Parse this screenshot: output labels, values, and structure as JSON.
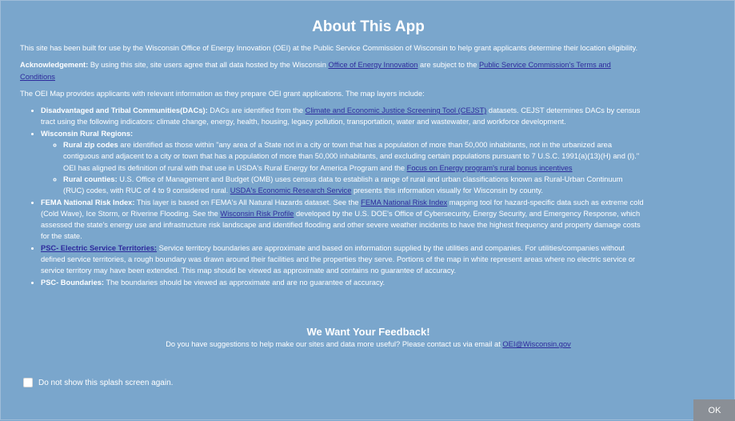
{
  "modal": {
    "title": "About This App",
    "intro": "This site has been built for use by the Wisconsin Office of Energy Innovation (OEI) at the Public Service Commission of Wisconsin to help grant applicants determine their location eligibility.",
    "ack_label": "Acknowledgement:",
    "ack_text_1": " By using this site, site users agree that all data hosted by the Wisconsin ",
    "ack_link_1": "Office of Energy Innovation",
    "ack_text_2": " are subject to the ",
    "ack_link_2a": "Public Service Commission's Terms and",
    "ack_link_2b": "Conditions",
    "map_intro": "The OEI Map provides applicants with relevant information as they prepare OEI grant applications. The map layers include:",
    "dac_label": "Disadvantaged and Tribal Communities(DACs):",
    "dac_text_1": " DACs are identified from the ",
    "dac_link": "Climate and Economic Justice Screening Tool (CEJST)",
    "dac_text_2": " datasets. CEJST determines DACs by census",
    "dac_text_3": "tract using the following indicators: climate change, energy, health, housing, legacy pollution, transportation, water and wastewater, and workforce development.",
    "rural_label": "Wisconsin Rural Regions:",
    "zip_label": "Rural zip codes",
    "zip_text_1": " are identified as those within \"any area of a State not in a city or town that has a population of more than 50,000 inhabitants, not in the urbanized area",
    "zip_text_2": "contiguous and adjacent to a city or town that has a population of more than 50,000 inhabitants, and excluding certain populations pursuant to 7 U.S.C. 1991(a)(13)(H) and (I).\"",
    "zip_text_3": "OEI has aligned its definition of rural with that use in USDA's Rural Energy for America Program and the ",
    "zip_link": "Focus on Energy program's rural bonus incentives",
    "counties_label": "Rural counties:",
    "counties_text_1": " U.S. Office of Management and Budget (OMB) uses census data to establish a range of rural and urban classifications known as Rural-Urban Continuum",
    "counties_text_2": "(RUC) codes, with RUC of 4 to 9 considered rural. ",
    "counties_link": "USDA's Economic Research Service",
    "counties_text_3": " presents this information visually for Wisconsin by county.",
    "fema_label": "FEMA National Risk Index:",
    "fema_text_1": " This layer is based on FEMA's All Natural Hazards dataset. See the ",
    "fema_link": "FEMA National Risk Index",
    "fema_text_2": " mapping tool for hazard-specific data such as extreme cold",
    "fema_text_3": "(Cold Wave), Ice Storm, or Riverine Flooding. See the ",
    "fema_link_2": "Wisconsin Risk Profile",
    "fema_text_4": " developed by the U.S. DOE's Office of Cybersecurity, Energy Security, and Emergency Response, which",
    "fema_text_5": "assessed the state's energy use and infrastructure risk landscape and identified flooding and other severe weather incidents to have the highest frequency and property damage costs",
    "fema_text_6": "for the state.",
    "psc_link": "PSC- Electric Service Territories:",
    "psc_text_1": " Service territory boundaries are approximate and based on information supplied by the utilities and companies. For utilities/companies without",
    "psc_text_2": "defined service territories, a rough boundary was drawn around their facilities and the properties they serve. Portions of the map in white represent areas where no electric service or",
    "psc_text_3": "service territory may have been extended. This map should be viewed as approximate and contains no guarantee of accuracy.",
    "bound_label": "PSC- Boundaries:",
    "bound_text": " The boundaries should be viewed as approximate and are no guarantee of accuracy.",
    "feedback_title": "We Want Your Feedback!",
    "feedback_text": "Do you have suggestions to help make our sites and data more useful? Please contact us via email at ",
    "feedback_email": "OEI@Wisconsin.gov",
    "splash_label": "Do not show this splash screen again.",
    "ok_label": "OK"
  },
  "colors": {
    "background": "#7aa6cc",
    "link": "#2d2a9c",
    "ok_button": "#8a8f96"
  }
}
